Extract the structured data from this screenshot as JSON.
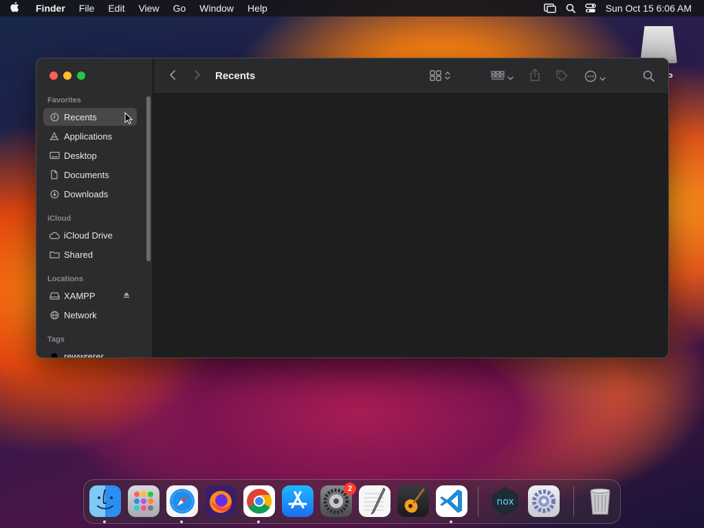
{
  "menubar": {
    "app_name": "Finder",
    "items": [
      "File",
      "Edit",
      "View",
      "Go",
      "Window",
      "Help"
    ],
    "clock": "Sun Oct 15  6:06 AM"
  },
  "desktop": {
    "drive_label": "P"
  },
  "finder": {
    "title": "Recents",
    "sidebar": {
      "favorites_header": "Favorites",
      "favorites": [
        {
          "label": "Recents",
          "icon": "clock-icon",
          "selected": true
        },
        {
          "label": "Applications",
          "icon": "applications-icon"
        },
        {
          "label": "Desktop",
          "icon": "desktop-icon"
        },
        {
          "label": "Documents",
          "icon": "document-icon"
        },
        {
          "label": "Downloads",
          "icon": "download-icon"
        }
      ],
      "icloud_header": "iCloud",
      "icloud": [
        {
          "label": "iCloud Drive",
          "icon": "cloud-icon"
        },
        {
          "label": "Shared",
          "icon": "shared-folder-icon"
        }
      ],
      "locations_header": "Locations",
      "locations": [
        {
          "label": "XAMPP",
          "icon": "drive-icon",
          "ejectable": true
        },
        {
          "label": "Network",
          "icon": "globe-icon"
        }
      ],
      "tags_header": "Tags",
      "tags": [
        {
          "label": "rewwrerer",
          "color": "#000000"
        }
      ]
    }
  },
  "dock": {
    "apps": [
      {
        "name": "Finder",
        "icon": "finder-icon",
        "running": true
      },
      {
        "name": "Launchpad",
        "icon": "launchpad-icon",
        "running": false
      },
      {
        "name": "Safari",
        "icon": "safari-icon",
        "running": true
      },
      {
        "name": "Firefox",
        "icon": "firefox-icon",
        "running": false
      },
      {
        "name": "Chrome",
        "icon": "chrome-icon",
        "running": true
      },
      {
        "name": "App Store",
        "icon": "app-store-icon",
        "running": false
      },
      {
        "name": "System Preferences",
        "icon": "system-preferences-icon",
        "running": false,
        "badge": "2"
      },
      {
        "name": "TextEdit",
        "icon": "textedit-icon",
        "running": false
      },
      {
        "name": "GarageBand",
        "icon": "garageband-icon",
        "running": false
      },
      {
        "name": "Visual Studio Code",
        "icon": "vscode-icon",
        "running": true
      },
      {
        "name": "Nox",
        "icon": "nox-icon",
        "running": false
      },
      {
        "name": "Settings",
        "icon": "settings-gear-icon",
        "running": false
      },
      {
        "name": "Trash",
        "icon": "trash-icon",
        "running": false
      }
    ]
  }
}
